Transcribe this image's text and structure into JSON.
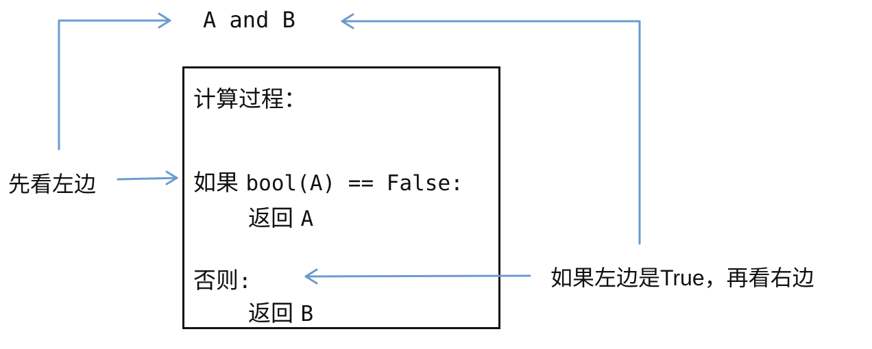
{
  "expression": {
    "left": "A",
    "op": "and",
    "right": "B"
  },
  "box": {
    "heading": "计算过程：",
    "if_keyword": "如果",
    "if_condition": "bool(A) == False:",
    "return_kw_1": "返回",
    "return_val_1": "A",
    "else_label": "否则",
    "else_colon": ":",
    "return_kw_2": "返回",
    "return_val_2": "B"
  },
  "labels": {
    "left_note": "先看左边",
    "right_note_cn1": "如果左边是",
    "right_note_true": "True",
    "right_note_cn2": "，再看右边"
  },
  "colors": {
    "arrow": "#6a9bd0",
    "text": "#111111",
    "border": "#111111"
  }
}
